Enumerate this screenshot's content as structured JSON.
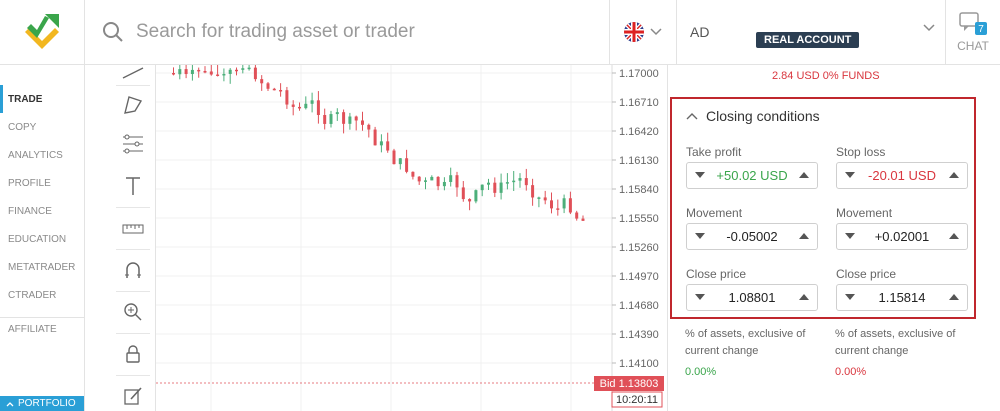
{
  "header": {
    "search_placeholder": "Search for trading asset or trader",
    "account_initials": "AD",
    "account_badge": "REAL ACCOUNT",
    "chat_label": "CHAT",
    "chat_count": "7"
  },
  "nav": {
    "items": [
      "TRADE",
      "COPY",
      "ANALYTICS",
      "PROFILE",
      "FINANCE",
      "EDUCATION",
      "METATRADER",
      "CTRADER"
    ],
    "affiliate": "AFFILIATE",
    "portfolio": "PORTFOLIO",
    "active": "TRADE"
  },
  "chart": {
    "price_labels": [
      "1.17000",
      "1.16710",
      "1.16420",
      "1.16130",
      "1.15840",
      "1.15550",
      "1.15260",
      "1.14970",
      "1.14680",
      "1.14390",
      "1.14100"
    ],
    "bid_label": "Bid 1.13803",
    "time_label": "10:20:11",
    "colors": {
      "up": "#4caf7a",
      "down": "#e05058"
    }
  },
  "panel": {
    "funds_text": "2.84 USD  0% FUNDS",
    "closing_title": "Closing conditions",
    "take_profit_label": "Take profit",
    "take_profit_value": "+50.02 USD",
    "stop_loss_label": "Stop loss",
    "stop_loss_value": "-20.01 USD",
    "movement_left_label": "Movement",
    "movement_left_value": "-0.05002",
    "movement_right_label": "Movement",
    "movement_right_value": "+0.02001",
    "close_price_left_label": "Close price",
    "close_price_left_value": "1.08801",
    "close_price_right_label": "Close price",
    "close_price_right_value": "1.15814",
    "note_left": "% of assets, exclusive of current change",
    "note_right": "% of assets, exclusive of current change",
    "pct_left": "0.00%",
    "pct_right": "0.00%",
    "colors": {
      "highlight_border": "#c0272d",
      "green": "#3aa54b",
      "red": "#d9363e"
    }
  }
}
